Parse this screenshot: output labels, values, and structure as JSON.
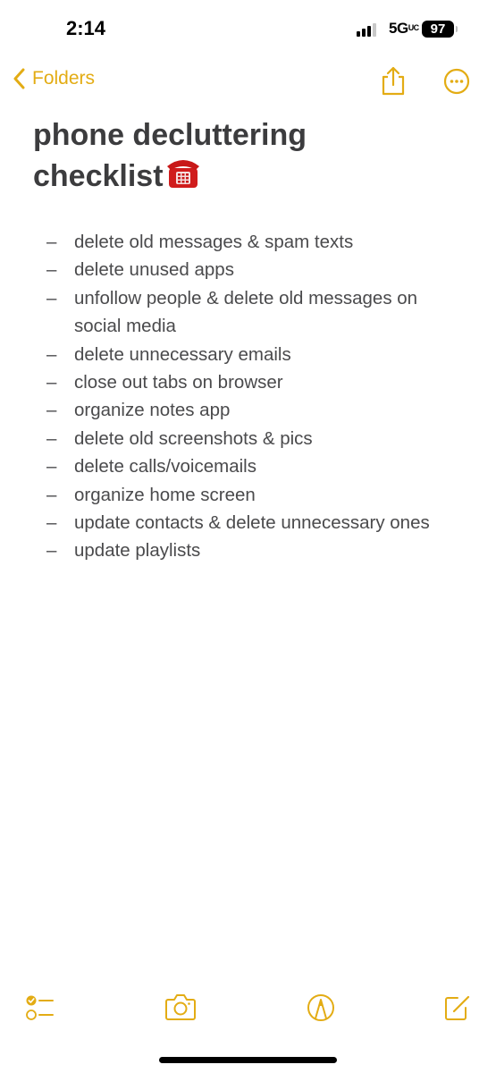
{
  "status_bar": {
    "time": "2:14",
    "network": "5G UC",
    "network_main": "5G",
    "network_sup": "UC",
    "battery": "97",
    "signal_bars_active": 3,
    "signal_bars_total": 4
  },
  "nav": {
    "back_label": "Folders",
    "share_icon": "share-icon",
    "more_icon": "ellipsis-circle-icon"
  },
  "note": {
    "title_line1": "phone decluttering",
    "title_line2": "checklist",
    "title_emoji": "☎️",
    "items": [
      "delete old messages & spam texts",
      "delete unused apps",
      "unfollow people & delete old messages on social media",
      "delete unnecessary emails",
      "close out tabs on browser",
      "organize notes app",
      "delete old screenshots & pics",
      "delete calls/voicemails",
      "organize home screen",
      "update contacts & delete unnecessary ones",
      "update playlists"
    ],
    "bullet": "–"
  },
  "toolbar": {
    "checklist_icon": "checklist-icon",
    "camera_icon": "camera-icon",
    "markup_icon": "markup-pen-icon",
    "compose_icon": "compose-icon"
  },
  "colors": {
    "accent": "#e3ac14",
    "text": "#4a4a4c",
    "background": "#ffffff"
  }
}
